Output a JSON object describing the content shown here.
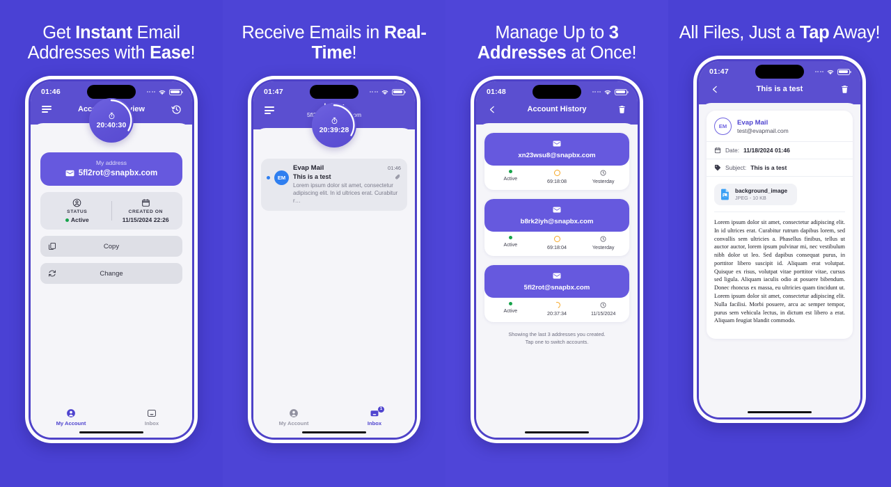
{
  "colors": {
    "background": "#4a41d4",
    "header_purple": "#5b4fd0",
    "card_purple": "#6659de",
    "accent": "#4f44cf",
    "green": "#16a34a",
    "orange": "#f5a623",
    "blue": "#2f7ff0"
  },
  "panels": [
    {
      "headline": {
        "part1": "Get ",
        "bold1": "Instant",
        "part2": " Email Addresses with ",
        "bold2": "Ease",
        "part3": "!"
      },
      "status": {
        "time": "01:46"
      },
      "appbar": {
        "title": "Account Overview",
        "left_icon": "hamburger-menu-icon",
        "right_icon": "history-clock-icon"
      },
      "timer": {
        "value": "20:40:30",
        "icon": "stopwatch-icon"
      },
      "address_card": {
        "label": "My address",
        "value": "5fl2rot@snapbx.com",
        "icon": "envelope-icon"
      },
      "info": [
        {
          "label": "STATUS",
          "value": "Active",
          "icon": "person-circle-icon",
          "has_dot": true
        },
        {
          "label": "CREATED ON",
          "value": "11/15/2024 22:26",
          "icon": "calendar-icon",
          "has_dot": false
        }
      ],
      "actions": [
        {
          "label": "Copy",
          "icon": "copy-icon"
        },
        {
          "label": "Change",
          "icon": "refresh-icon"
        }
      ],
      "tabs": [
        {
          "label": "My Account",
          "icon": "person-icon",
          "active": true,
          "badge": ""
        },
        {
          "label": "Inbox",
          "icon": "inbox-icon",
          "active": false,
          "badge": ""
        }
      ]
    },
    {
      "headline": {
        "part1": "Receive Emails in ",
        "bold1": "Real-Time",
        "part2": "",
        "bold2": "",
        "part3": "!"
      },
      "status": {
        "time": "01:47"
      },
      "appbar": {
        "title": "Inbox",
        "subtitle": "5fl2rot@snapbx.com",
        "left_icon": "hamburger-menu-icon"
      },
      "timer": {
        "value": "20:39:28",
        "icon": "stopwatch-icon"
      },
      "mail": {
        "avatar_initials": "EM",
        "from": "Evap Mail",
        "time": "01:46",
        "subject": "This is a test",
        "preview": "Lorem ipsum dolor sit amet, consectetur adipiscing elit. In id ultrices erat. Curabitur r…",
        "attachment_icon": "paperclip-icon"
      },
      "tabs": [
        {
          "label": "My Account",
          "icon": "person-icon",
          "active": false,
          "badge": ""
        },
        {
          "label": "Inbox",
          "icon": "inbox-icon",
          "active": true,
          "badge": "1"
        }
      ]
    },
    {
      "headline": {
        "part1": "Manage Up to ",
        "bold1": "3",
        "part2": " ",
        "bold2": "Addresses",
        "part3": " at Once!"
      },
      "status": {
        "time": "01:48"
      },
      "appbar": {
        "title": "Account History",
        "left_icon": "back-chevron-icon",
        "right_icon": "trash-icon"
      },
      "history": [
        {
          "email": "xn23wsu8@snapbx.com",
          "status": "Active",
          "timer": "69:18:08",
          "date": "Yesterday",
          "ring": "full"
        },
        {
          "email": "b8rk2iyh@snapbx.com",
          "status": "Active",
          "timer": "69:18:04",
          "date": "Yesterday",
          "ring": "full"
        },
        {
          "email": "5fl2rot@snapbx.com",
          "status": "Active",
          "timer": "20:37:34",
          "date": "11/15/2024",
          "ring": "partial"
        }
      ],
      "footer_line1": "Showing the last 3 addresses you created.",
      "footer_line2": "Tap one to switch accounts."
    },
    {
      "headline": {
        "part1": "All Files, Just a ",
        "bold1": "Tap",
        "part2": " Away!",
        "bold2": "",
        "part3": ""
      },
      "status": {
        "time": "01:47"
      },
      "appbar": {
        "title": "This is a test",
        "left_icon": "back-chevron-icon",
        "right_icon": "trash-icon"
      },
      "detail": {
        "avatar_initials": "EM",
        "sender_name": "Evap Mail",
        "sender_email": "test@evapmail.com",
        "date_label": "Date:",
        "date_value": "11/18/2024 01:46",
        "subject_label": "Subject:",
        "subject_value": "This is a test",
        "attachment_name": "background_image",
        "attachment_meta": "JPEG - 10 KB",
        "body": "Lorem ipsum dolor sit amet, consectetur adipiscing elit. In id ultrices erat. Curabitur rutrum dapibus lorem, sed convallis sem ultricies a. Phasellus finibus, tellus ut auctor auctor, lorem ipsum pulvinar mi, nec vestibulum nibh dolor ut leo. Sed dapibus consequat purus, in porttitor libero suscipit id. Aliquam erat volutpat. Quisque ex risus, volutpat vitae porttitor vitae, cursus sed ligula. Aliquam iaculis odio at posuere bibendum. Donec rhoncus ex massa, eu ultricies quam tincidunt ut. Lorem ipsum dolor sit amet, consectetur adipiscing elit. Nulla facilisi. Morbi posuere, arcu ac semper tempor, purus sem vehicula lectus, in dictum est libero a erat. Aliquam feugiat blandit commodo."
      }
    }
  ]
}
